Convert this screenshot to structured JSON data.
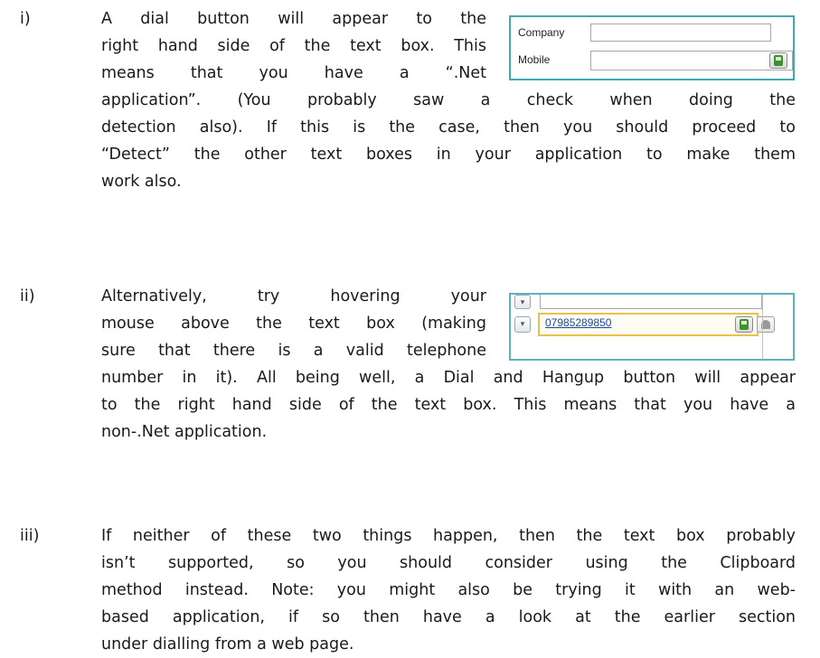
{
  "items": [
    {
      "marker": "i)",
      "lines": [
        "A dial button will appear to the",
        "right hand side of the text box. This",
        "means that you have a “.Net",
        "application”. (You probably saw a check when doing the",
        "detection also). If this is the case, then you should proceed to",
        "“Detect” the other text boxes in your application to make them",
        "work also."
      ]
    },
    {
      "marker": "ii)",
      "lines": [
        "Alternatively, try hovering your",
        "mouse above the text box (making",
        "sure that there is a valid telephone",
        "number in it). All being well, a Dial and Hangup button will appear",
        "to the right hand side of the text box. This means that you have a",
        "non-.Net application."
      ]
    },
    {
      "marker": "iii)",
      "lines": [
        "If neither of these two things happen, then the text box probably",
        "isn’t supported, so you should consider using the Clipboard",
        "method instead. Note: you might also be trying it with an web-",
        "based application, if so then have a look at the earlier section",
        "under dialling from a web page."
      ]
    }
  ],
  "screenshot1": {
    "company_label": "Company",
    "mobile_label": "Mobile",
    "dial_icon": "phone-dial-icon"
  },
  "screenshot2": {
    "phone_number": "07985289850",
    "dial_icon": "phone-dial-icon",
    "hangup_icon": "phone-hangup-icon"
  }
}
